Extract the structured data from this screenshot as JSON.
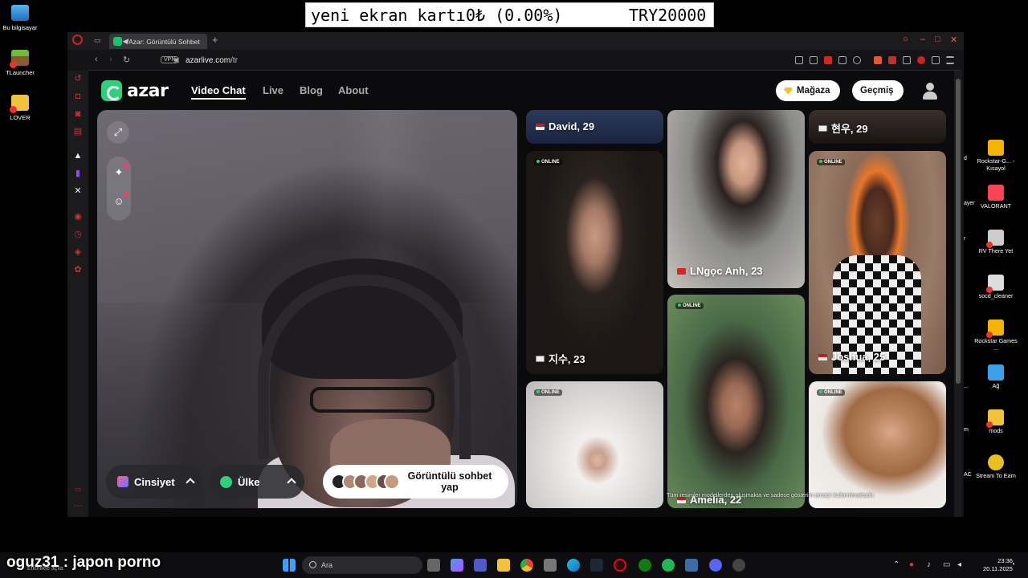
{
  "overlay": {
    "banner_item": "yeni ekran kartı",
    "banner_value": "0₺ (0.00%)",
    "banner_goal": "TRY20000",
    "chat_line": "oguz31 : japon porno",
    "chat_sub": "Etkinlikte açıla"
  },
  "desktop_left": [
    {
      "label": "Bu bilgisayar"
    },
    {
      "label": "TLauncher"
    },
    {
      "label": "LOVER"
    }
  ],
  "desktop_right": [
    {
      "label": "Rockstar-G... - Kısayol"
    },
    {
      "label": "VALORANT"
    },
    {
      "label": "RV There Yet"
    },
    {
      "label": "socd_cleaner"
    },
    {
      "label": "Rockstar Games ..."
    },
    {
      "label": "Ağ"
    },
    {
      "label": "mods"
    },
    {
      "label": "Stream To Earn"
    }
  ],
  "desktop_right_clipped": [
    "d",
    "ayer",
    "r",
    "...",
    "m",
    "AC"
  ],
  "browser": {
    "tab_title": "Azar: Görüntülü Sohbet",
    "url_domain": "azarlive.com",
    "url_path": "/tr",
    "vpn_label": "VPN"
  },
  "site": {
    "logo_text": "azar",
    "nav": [
      {
        "label": "Video Chat",
        "active": true
      },
      {
        "label": "Live"
      },
      {
        "label": "Blog"
      },
      {
        "label": "About"
      }
    ],
    "store_label": "Mağaza",
    "history_label": "Geçmiş",
    "gender_filter": "Cinsiyet",
    "country_filter": "Ülke",
    "start_label": "Görüntülü sohbet yap",
    "online_badge": "ONLINE",
    "disclaimer": "Tüm resimler modellerden oluşmakta ve sadece gösterim amaçlı kullanılmaktadır."
  },
  "gallery": [
    {
      "name": "David, 29",
      "flag": "us",
      "online": false
    },
    {
      "name": "지수, 23",
      "flag": "kr",
      "online": true
    },
    {
      "name": "",
      "flag": "",
      "online": true
    },
    {
      "name": "LNgọc Anh, 23",
      "flag": "vn",
      "online": false
    },
    {
      "name": "Amelia, 22",
      "flag": "us",
      "online": true
    },
    {
      "name": "현우, 29",
      "flag": "kr",
      "online": false
    },
    {
      "name": "Joshua, 25",
      "flag": "us",
      "online": true
    },
    {
      "name": "",
      "flag": "",
      "online": true
    }
  ],
  "taskbar": {
    "search_placeholder": "Ara",
    "time": "23:36",
    "date": "20.11.2025"
  }
}
